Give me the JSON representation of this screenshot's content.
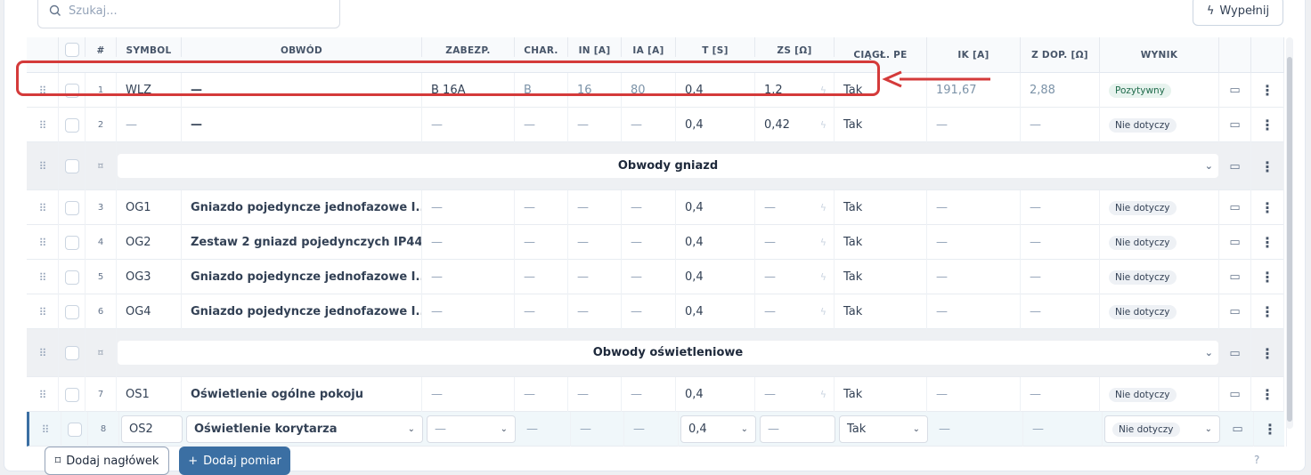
{
  "search": {
    "placeholder": "Szukaj..."
  },
  "toolbar": {
    "fill_label": "Wypełnij"
  },
  "columns": [
    "#",
    "SYMBOL",
    "OBWÓD",
    "ZABEZP.",
    "CHAR.",
    "IN [A]",
    "IA [A]",
    "T [S]",
    "ZS [Ω]",
    "CIĄGŁ. PE",
    "IK [A]",
    "Z DOP. [Ω]",
    "WYNIK"
  ],
  "rows": [
    {
      "num": "1",
      "symbol": "WLZ",
      "circuit": "—",
      "protection": "B 16A",
      "char": "B",
      "in": "16",
      "ia": "80",
      "t": "0,4",
      "zs": "1,2",
      "pe": "Tak",
      "ik": "191,67",
      "zdop": "2,88",
      "result": "Pozytywny"
    },
    {
      "num": "2",
      "symbol": "—",
      "circuit": "—",
      "protection": "—",
      "char": "—",
      "in": "—",
      "ia": "—",
      "t": "0,4",
      "zs": "0,42",
      "pe": "Tak",
      "ik": "—",
      "zdop": "—",
      "result": "Nie dotyczy"
    },
    {
      "group": "Obwody gniazd"
    },
    {
      "num": "3",
      "symbol": "OG1",
      "circuit": "Gniazdo pojedyncze jednofazowe I...",
      "protection": "—",
      "char": "—",
      "in": "—",
      "ia": "—",
      "t": "0,4",
      "zs": "—",
      "pe": "Tak",
      "ik": "—",
      "zdop": "—",
      "result": "Nie dotyczy"
    },
    {
      "num": "4",
      "symbol": "OG2",
      "circuit": "Zestaw 2 gniazd pojedynczych IP44",
      "protection": "—",
      "char": "—",
      "in": "—",
      "ia": "—",
      "t": "0,4",
      "zs": "—",
      "pe": "Tak",
      "ik": "—",
      "zdop": "—",
      "result": "Nie dotyczy"
    },
    {
      "num": "5",
      "symbol": "OG3",
      "circuit": "Gniazdo pojedyncze jednofazowe I...",
      "protection": "—",
      "char": "—",
      "in": "—",
      "ia": "—",
      "t": "0,4",
      "zs": "—",
      "pe": "Tak",
      "ik": "—",
      "zdop": "—",
      "result": "Nie dotyczy"
    },
    {
      "num": "6",
      "symbol": "OG4",
      "circuit": "Gniazdo pojedyncze jednofazowe I...",
      "protection": "—",
      "char": "—",
      "in": "—",
      "ia": "—",
      "t": "0,4",
      "zs": "—",
      "pe": "Tak",
      "ik": "—",
      "zdop": "—",
      "result": "Nie dotyczy"
    },
    {
      "group": "Obwody oświetleniowe"
    },
    {
      "num": "7",
      "symbol": "OS1",
      "circuit": "Oświetlenie ogólne pokoju",
      "protection": "—",
      "char": "—",
      "in": "—",
      "ia": "—",
      "t": "0,4",
      "zs": "—",
      "pe": "Tak",
      "ik": "—",
      "zdop": "—",
      "result": "Nie dotyczy"
    },
    {
      "num": "8",
      "symbol": "OS2",
      "circuit": "Oświetlenie korytarza",
      "protection": "—",
      "char": "—",
      "in": "—",
      "ia": "—",
      "t": "0,4",
      "zs": "—",
      "pe": "Tak",
      "ik": "—",
      "zdop": "—",
      "result": "Nie dotyczy"
    }
  ],
  "footer": {
    "add_header_label": "Dodaj nagłówek",
    "add_measurement_label": "Dodaj pomiar",
    "help": "?"
  },
  "colors": {
    "accent": "#3b6fa3",
    "highlight": "#d43a3a",
    "badge_positive": "#e7f3ee"
  }
}
